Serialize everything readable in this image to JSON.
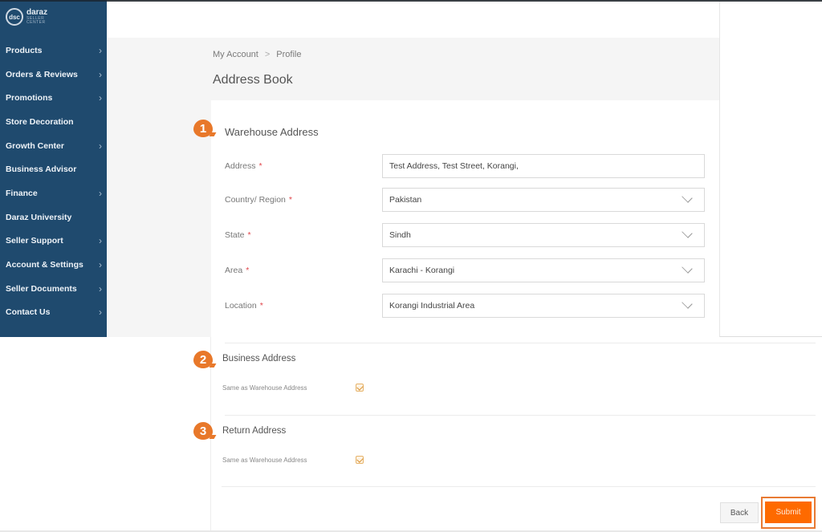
{
  "app": {
    "logo_mark": "dsc",
    "logo_brand": "daraz",
    "logo_sub1": "SELLER",
    "logo_sub2": "CENTER"
  },
  "sidebar": {
    "items": [
      {
        "label": "Products",
        "has_submenu": true
      },
      {
        "label": "Orders & Reviews",
        "has_submenu": true
      },
      {
        "label": "Promotions",
        "has_submenu": true
      },
      {
        "label": "Store Decoration",
        "has_submenu": false
      },
      {
        "label": "Growth Center",
        "has_submenu": true
      },
      {
        "label": "Business Advisor",
        "has_submenu": false
      },
      {
        "label": "Finance",
        "has_submenu": true
      },
      {
        "label": "Daraz University",
        "has_submenu": false
      },
      {
        "label": "Seller Support",
        "has_submenu": true
      },
      {
        "label": "Account & Settings",
        "has_submenu": true
      },
      {
        "label": "Seller Documents",
        "has_submenu": true
      },
      {
        "label": "Contact Us",
        "has_submenu": true
      }
    ],
    "chevron": "›"
  },
  "breadcrumb": {
    "items": [
      "My Account",
      "Profile"
    ],
    "separator": ">"
  },
  "page_title": "Address Book",
  "warehouse": {
    "step": "1",
    "title": "Warehouse Address",
    "required_mark": "*",
    "fields": [
      {
        "label": "Address",
        "value": "Test Address, Test Street, Korangi,",
        "type": "text"
      },
      {
        "label": "Country/ Region",
        "value": "Pakistan",
        "type": "select"
      },
      {
        "label": "State",
        "value": "Sindh",
        "type": "select"
      },
      {
        "label": "Area",
        "value": "Karachi - Korangi",
        "type": "select"
      },
      {
        "label": "Location",
        "value": "Korangi Industrial Area",
        "type": "select"
      }
    ]
  },
  "business": {
    "step": "2",
    "title": "Business Address",
    "checkbox_label": "Same as Warehouse Address",
    "checked": true
  },
  "return": {
    "step": "3",
    "title": "Return Address",
    "checkbox_label": "Same as Warehouse Address",
    "checked": true
  },
  "actions": {
    "back_label": "Back",
    "submit_label": "Submit"
  },
  "colors": {
    "sidebar_bg": "#1f4a6e",
    "accent": "#fe6a00",
    "step_badge": "#e8782a",
    "required": "#e0454a"
  }
}
